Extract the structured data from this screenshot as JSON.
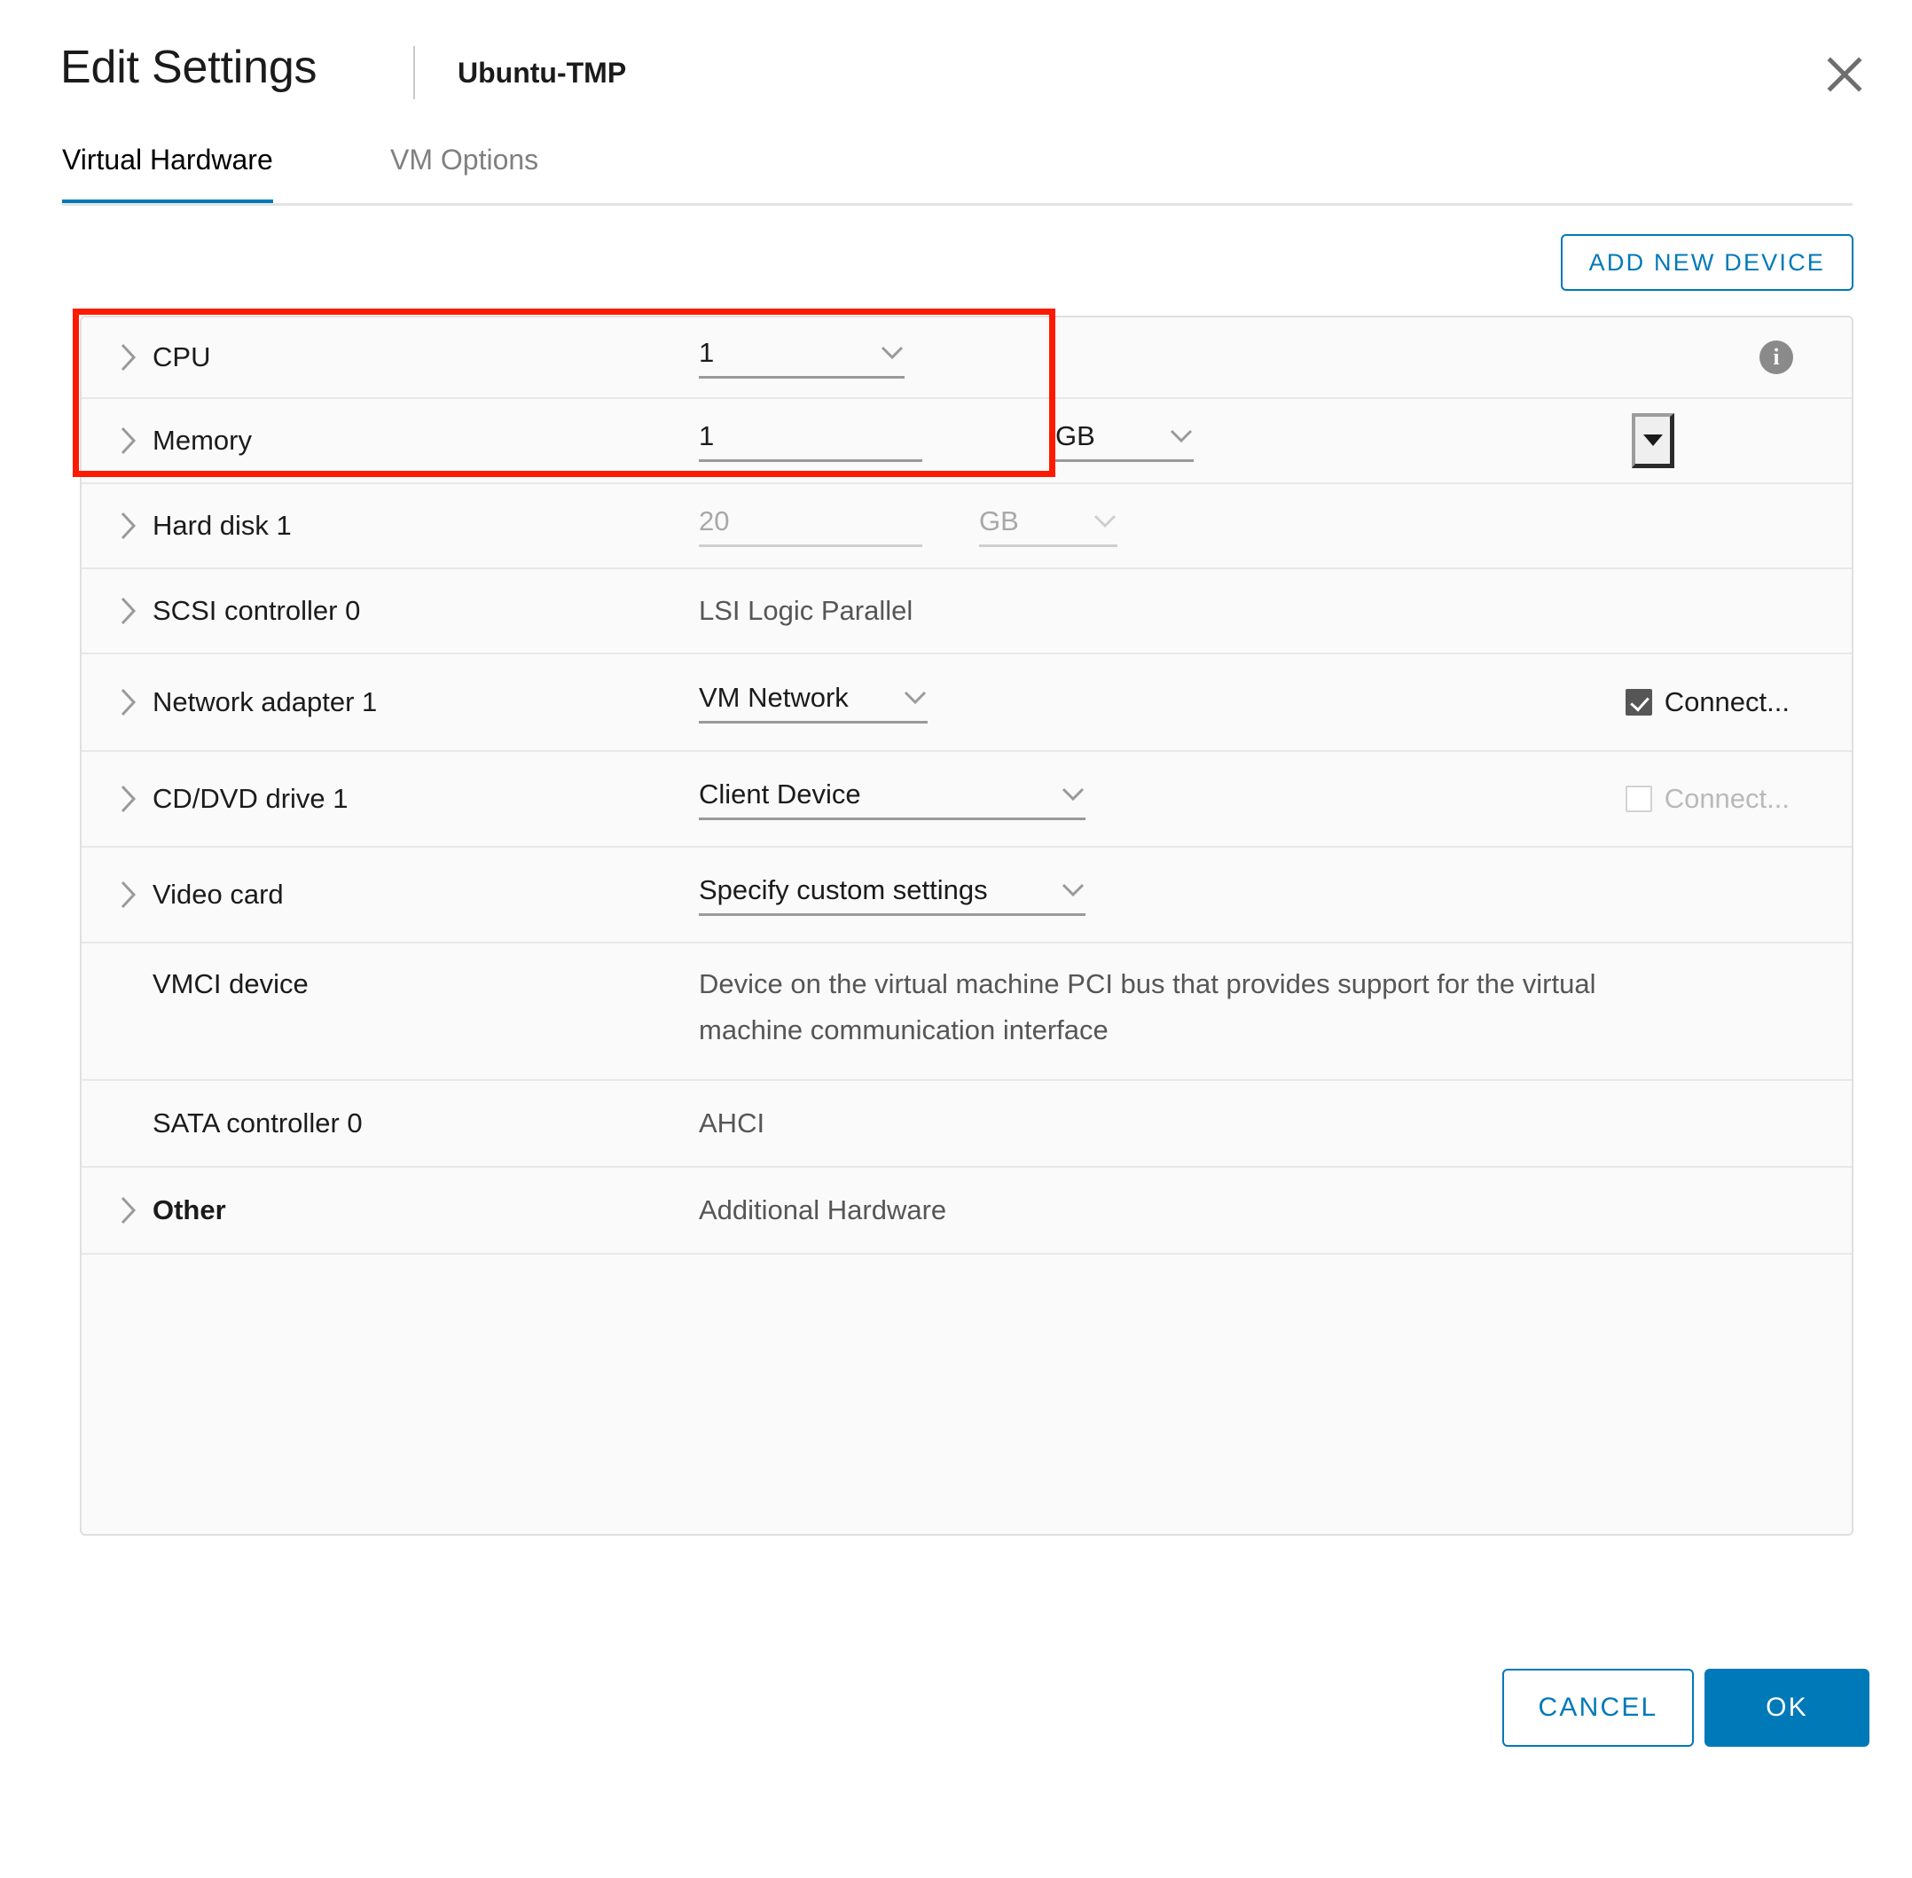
{
  "header": {
    "title": "Edit Settings",
    "subtitle": "Ubuntu-TMP",
    "close_icon": "close-icon"
  },
  "tabs": [
    {
      "label": "Virtual Hardware",
      "active": true
    },
    {
      "label": "VM Options",
      "active": false
    }
  ],
  "toolbar": {
    "add_device_label": "ADD NEW DEVICE"
  },
  "colors": {
    "accent": "#0079b8",
    "annotation": "#fc1b00",
    "panel_bg": "#fafafa",
    "row_divider": "#e8e8e8",
    "disabled_text": "#a8a8a8"
  },
  "devices": [
    {
      "label": "CPU",
      "value": "1",
      "unit": "",
      "info_icon": "info-icon"
    },
    {
      "label": "Memory",
      "value": "1",
      "unit": "GB"
    },
    {
      "label": "Hard disk 1",
      "value": "20",
      "unit": "GB"
    },
    {
      "label": "SCSI controller 0",
      "value": "LSI Logic Parallel"
    },
    {
      "label": "Network adapter 1",
      "value": "VM Network",
      "connect_label": "Connect..."
    },
    {
      "label": "CD/DVD drive 1",
      "value": "Client Device",
      "connect_label": "Connect..."
    },
    {
      "label": "Video card",
      "value": "Specify custom settings"
    },
    {
      "label": "VMCI device",
      "value": "Device on the virtual machine PCI bus that provides support for the virtual machine communication interface"
    },
    {
      "label": "SATA controller 0",
      "value": "AHCI"
    },
    {
      "label": "Other",
      "value": "Additional Hardware"
    }
  ],
  "footer": {
    "cancel_label": "CANCEL",
    "ok_label": "OK"
  }
}
